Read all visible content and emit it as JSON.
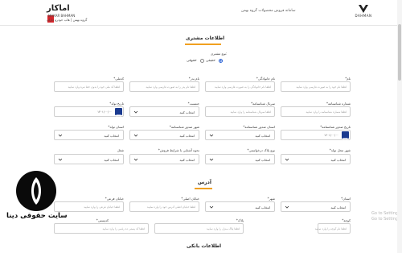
{
  "header": {
    "title": "سامانه فروش محصولات گروه بهمن",
    "brand_mark": "اماکار",
    "brand_sub1": "MAKAR BAHMAN",
    "brand_sub2": "گروه بهمن | هاب خودرو داران",
    "dahman_text": "DAHMAN"
  },
  "customer_section": {
    "title": "اطلاعات مشتری",
    "customer_type_label": "نوع مشتری:",
    "options": [
      "حقیقی",
      "حقوقی"
    ],
    "selected": "حقیقی"
  },
  "rows": {
    "r1": [
      {
        "label": "*نام",
        "placeholder": "لطفا نام خود را به صورت فارسی وارد نمایید"
      },
      {
        "label": "*نام خانوادگی",
        "placeholder": "لطفا نام خانوادگی را به صورت فارسی وارد نمایید"
      },
      {
        "label": "*نام پدر",
        "placeholder": "لطفا نام پدر را به صورت فارسی وارد نمایید"
      },
      {
        "label": "*کدملی",
        "placeholder": "لطفا کد ملی خود را بدون خط تیره وارد نمایید"
      }
    ],
    "r2": [
      {
        "label": "*شماره شناسنامه",
        "placeholder": "لطفا شماره شناسنامه را وارد نمایید"
      },
      {
        "label": "*سریال شناسنامه",
        "placeholder": "لطفا سریال شناسنامه را وارد نمایید"
      },
      {
        "label": "*جنسیت",
        "value": "انتخاب کنید"
      },
      {
        "label": "*تاریخ تولد",
        "date": "۱۴۰۱/۰۰/۰۰"
      }
    ],
    "r3": [
      {
        "label": "*تاریخ صدور شناسنامه",
        "date": "۱۴۰۱/۰۰/۰۰"
      },
      {
        "label": "*استان صدور شناسنامه",
        "value": "انتخاب کنید"
      },
      {
        "label": "*شهر صدور شناسنامه",
        "value": "انتخاب کنید"
      },
      {
        "label": "*استان تولد",
        "value": "انتخاب کنید"
      }
    ],
    "r4": [
      {
        "label": "*شهر محل تولد",
        "value": "انتخاب کنید"
      },
      {
        "label": "*نوع پلاک درخواستی",
        "value": "انتخاب کنید"
      },
      {
        "label": "*نحوه آشنایی با شرایط فروش",
        "value": "انتخاب کنید"
      },
      {
        "label": "شغل",
        "value": "انتخاب کنید"
      }
    ]
  },
  "address_section": {
    "title": "آدرس",
    "row1": [
      {
        "label": "*استان",
        "value": "انتخاب کنید"
      },
      {
        "label": "*شهر",
        "value": "انتخاب کنید"
      },
      {
        "label": "*خیابان اصلی",
        "placeholder": "لطفا خیابان اصلی آدرس خود را وارد نمایید"
      },
      {
        "label": "*خیابان فرعی",
        "placeholder": "لطفا خیابان فرعی را وارد نمایید"
      }
    ],
    "row2": [
      {
        "label": "*کوچه",
        "placeholder": "لطفا نام کوچه را وارد نمایید"
      },
      {
        "label": "*پلاک",
        "placeholder": "لطفا پلاک منزل را وارد نمایید"
      },
      {
        "label": "*کدپستی",
        "placeholder": "لطفا کد پستی ده رقمی را وارد نمایید"
      }
    ]
  },
  "bank_section": {
    "title": "اطلاعات بانکی"
  },
  "watermark": {
    "site_text": "سایت حقوقی دینا"
  },
  "os_overlay": {
    "line1": "Go to Settings",
    "line2": "Go to Settings"
  }
}
